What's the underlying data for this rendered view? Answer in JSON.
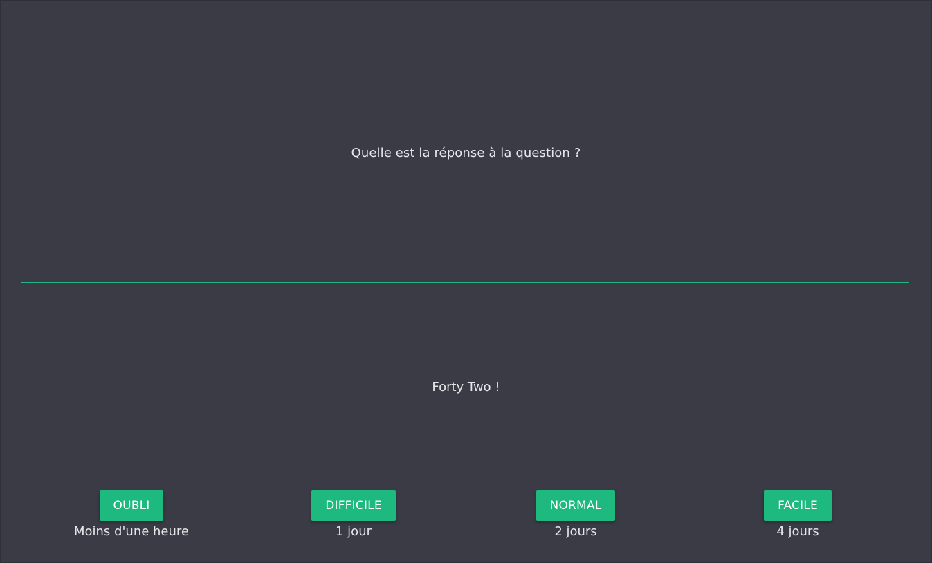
{
  "card": {
    "question": "Quelle est la réponse à la question ?",
    "answer": "Forty Two !"
  },
  "grades": [
    {
      "label": "OUBLI",
      "interval": "Moins d'une heure"
    },
    {
      "label": "DIFFICILE",
      "interval": "1 jour"
    },
    {
      "label": "NORMAL",
      "interval": "2 jours"
    },
    {
      "label": "FACILE",
      "interval": "4 jours"
    }
  ],
  "colors": {
    "background": "#3a3b45",
    "accent": "#1db97f",
    "text": "#e6e6ea"
  }
}
